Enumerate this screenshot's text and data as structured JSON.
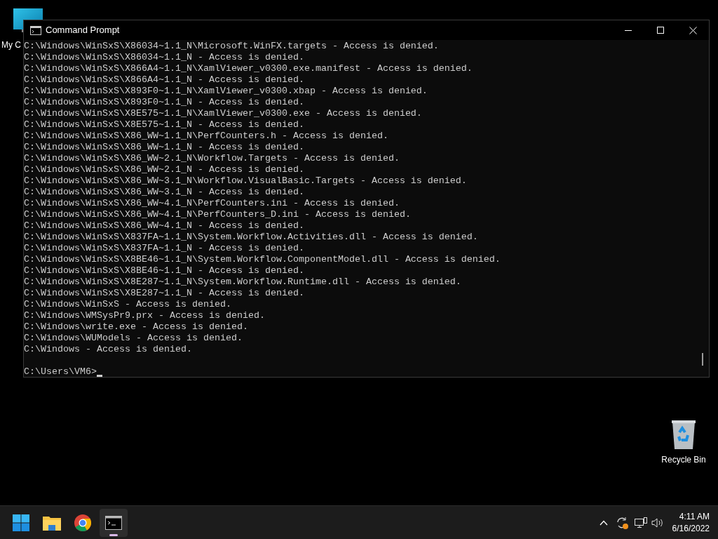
{
  "desktop_icons": [
    {
      "kind": "computer",
      "label": "My C"
    },
    {
      "kind": "recycle",
      "label": "Recycle Bin"
    }
  ],
  "window": {
    "title": "Command Prompt",
    "lines": [
      "C:\\Windows\\WinSxS\\X86034~1.1_N\\Microsoft.WinFX.targets - Access is denied.",
      "C:\\Windows\\WinSxS\\X86034~1.1_N - Access is denied.",
      "C:\\Windows\\WinSxS\\X866A4~1.1_N\\XamlViewer_v0300.exe.manifest - Access is denied.",
      "C:\\Windows\\WinSxS\\X866A4~1.1_N - Access is denied.",
      "C:\\Windows\\WinSxS\\X893F0~1.1_N\\XamlViewer_v0300.xbap - Access is denied.",
      "C:\\Windows\\WinSxS\\X893F0~1.1_N - Access is denied.",
      "C:\\Windows\\WinSxS\\X8E575~1.1_N\\XamlViewer_v0300.exe - Access is denied.",
      "C:\\Windows\\WinSxS\\X8E575~1.1_N - Access is denied.",
      "C:\\Windows\\WinSxS\\X86_WW~1.1_N\\PerfCounters.h - Access is denied.",
      "C:\\Windows\\WinSxS\\X86_WW~1.1_N - Access is denied.",
      "C:\\Windows\\WinSxS\\X86_WW~2.1_N\\Workflow.Targets - Access is denied.",
      "C:\\Windows\\WinSxS\\X86_WW~2.1_N - Access is denied.",
      "C:\\Windows\\WinSxS\\X86_WW~3.1_N\\Workflow.VisualBasic.Targets - Access is denied.",
      "C:\\Windows\\WinSxS\\X86_WW~3.1_N - Access is denied.",
      "C:\\Windows\\WinSxS\\X86_WW~4.1_N\\PerfCounters.ini - Access is denied.",
      "C:\\Windows\\WinSxS\\X86_WW~4.1_N\\PerfCounters_D.ini - Access is denied.",
      "C:\\Windows\\WinSxS\\X86_WW~4.1_N - Access is denied.",
      "C:\\Windows\\WinSxS\\X837FA~1.1_N\\System.Workflow.Activities.dll - Access is denied.",
      "C:\\Windows\\WinSxS\\X837FA~1.1_N - Access is denied.",
      "C:\\Windows\\WinSxS\\X8BE46~1.1_N\\System.Workflow.ComponentModel.dll - Access is denied.",
      "C:\\Windows\\WinSxS\\X8BE46~1.1_N - Access is denied.",
      "C:\\Windows\\WinSxS\\X8E287~1.1_N\\System.Workflow.Runtime.dll - Access is denied.",
      "C:\\Windows\\WinSxS\\X8E287~1.1_N - Access is denied.",
      "C:\\Windows\\WinSxS - Access is denied.",
      "C:\\Windows\\WMSysPr9.prx - Access is denied.",
      "C:\\Windows\\write.exe - Access is denied.",
      "C:\\Windows\\WUModels - Access is denied.",
      "C:\\Windows - Access is denied."
    ],
    "prompt": "C:\\Users\\VM6>"
  },
  "taskbar": {
    "apps": [
      {
        "kind": "start",
        "selected": false
      },
      {
        "kind": "folder",
        "selected": false
      },
      {
        "kind": "browser",
        "selected": false
      },
      {
        "kind": "terminal",
        "selected": true
      }
    ],
    "time": "4:11 AM",
    "date": "6/16/2022"
  }
}
